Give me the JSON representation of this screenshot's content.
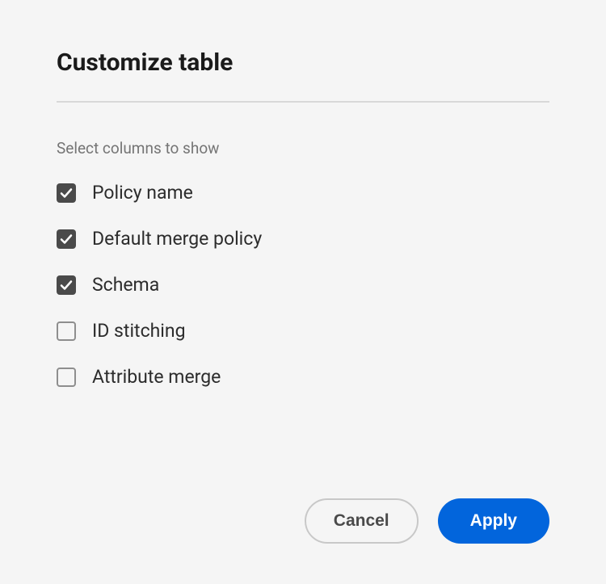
{
  "dialog": {
    "title": "Customize table",
    "subtitle": "Select columns to show",
    "options": [
      {
        "label": "Policy name",
        "checked": true
      },
      {
        "label": "Default merge policy",
        "checked": true
      },
      {
        "label": "Schema",
        "checked": true
      },
      {
        "label": "ID stitching",
        "checked": false
      },
      {
        "label": "Attribute merge",
        "checked": false
      }
    ],
    "buttons": {
      "cancel": "Cancel",
      "apply": "Apply"
    }
  }
}
